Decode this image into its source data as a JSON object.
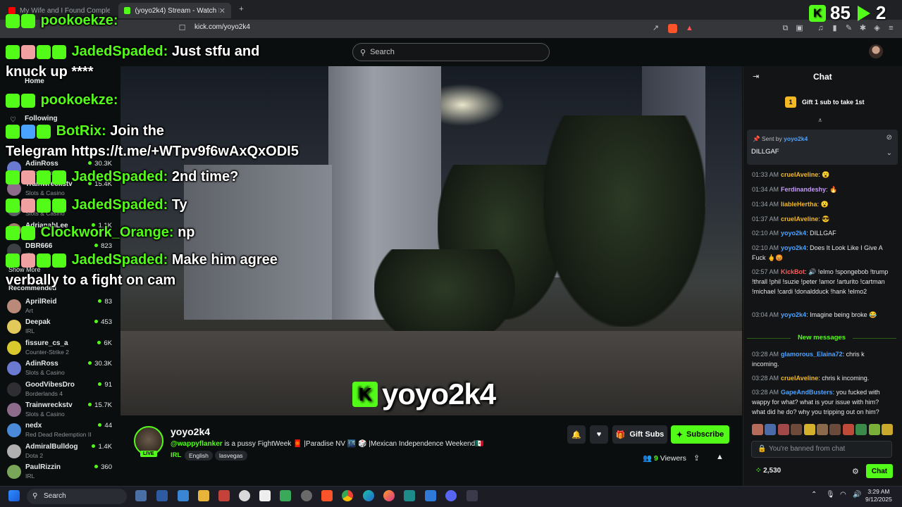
{
  "browser": {
    "tabs": [
      {
        "title": "My Wife and I Found Complex Prehi"
      },
      {
        "title": "(yoyo2k4) Stream - Watch Live"
      }
    ],
    "url": "kick.com/yoyo2k4"
  },
  "header": {
    "search_placeholder": "Search"
  },
  "sidebar": {
    "home": "Home",
    "following": "Following",
    "show_more": "Show More",
    "recommended": "Recommended",
    "following_channels": [
      {
        "name": "AdinRoss",
        "category": "Slots & Casino",
        "viewers": "30.3K"
      },
      {
        "name": "Trainwreckstv",
        "category": "Slots & Casino",
        "viewers": "15.4K"
      },
      {
        "name": "",
        "category": "Slots & Casino",
        "viewers": ""
      },
      {
        "name": "AdrianahLee",
        "category": "",
        "viewers": "1.1K"
      },
      {
        "name": "DBR666",
        "category": "IRL",
        "viewers": "823"
      }
    ],
    "recommended_channels": [
      {
        "name": "AprilReid",
        "category": "Art",
        "viewers": "83"
      },
      {
        "name": "Deepak",
        "category": "IRL",
        "viewers": "453"
      },
      {
        "name": "fissure_cs_a",
        "category": "Counter-Strike 2",
        "viewers": "6K"
      },
      {
        "name": "AdinRoss",
        "category": "Slots & Casino",
        "viewers": "30.3K"
      },
      {
        "name": "GoodVibesDro",
        "category": "Borderlands 4",
        "viewers": "91"
      },
      {
        "name": "Trainwreckstv",
        "category": "Slots & Casino",
        "viewers": "15.7K"
      },
      {
        "name": "nedx",
        "category": "Red Dead Redemption II",
        "viewers": "44"
      },
      {
        "name": "AdmiralBulldog",
        "category": "Dota 2",
        "viewers": "1.4K"
      },
      {
        "name": "PaulRizzin",
        "category": "IRL",
        "viewers": "360"
      }
    ]
  },
  "overlay": {
    "counter": {
      "a": "85",
      "b": "2"
    },
    "messages": [
      {
        "user": "pookoekze:",
        "text": ""
      },
      {
        "user": "JadedSpaded:",
        "text": "Just stfu and"
      },
      {
        "user": "",
        "text": "knuck up ****"
      },
      {
        "user": "pookoekze:",
        "text": ""
      },
      {
        "user": "BotRix:",
        "text": "Join the"
      },
      {
        "user": "",
        "text": "Telegram https://t.me/+WTpv9f6wAxQxODI5"
      },
      {
        "user": "JadedSpaded:",
        "text": "2nd time?"
      },
      {
        "user": "JadedSpaded:",
        "text": "Ty"
      },
      {
        "user": "Clockwork_Orange:",
        "text": "np"
      },
      {
        "user": "JadedSpaded:",
        "text": "Make him agree"
      },
      {
        "user": "",
        "text": "verbally to a fight on cam"
      }
    ]
  },
  "video": {
    "watermark": "yoyo2k4"
  },
  "stream": {
    "streamer": "yoyo2k4",
    "live": "LIVE",
    "mention": "@wappyflanker",
    "title_rest": " is a pussy FightWeek 🧧 |Paradise NV 🌃 🎲 |Mexican Independence Weekend🇲🇽",
    "category": "IRL",
    "tags": [
      "English",
      "lasvegas"
    ],
    "viewers_count": "9",
    "viewers_label": "Viewers",
    "gift_subs": "Gift Subs",
    "subscribe": "Subscribe"
  },
  "chat": {
    "title": "Chat",
    "gift_leader": "Gift 1 sub to take 1st",
    "gift_rank": "1",
    "pinned": {
      "sent_by": "Sent by",
      "user": "yoyo2k4",
      "message": "DILLGAF"
    },
    "new_messages": "New messages",
    "messages": [
      {
        "time": "01:33 AM",
        "user": "cruelAveline",
        "color": "#f3b824",
        "text": ": 😮"
      },
      {
        "time": "01:34 AM",
        "user": "Ferdinandeshy",
        "color": "#c49cf8",
        "text": ": 🔥"
      },
      {
        "time": "01:34 AM",
        "user": "liableHertha",
        "color": "#f3b824",
        "text": ": 😮"
      },
      {
        "time": "01:37 AM",
        "user": "cruelAveline",
        "color": "#f3b824",
        "text": ": 😎"
      },
      {
        "time": "02:10 AM",
        "user": "yoyo2k4",
        "color": "#4da3ff",
        "text": ": DILLGAF"
      },
      {
        "time": "02:10 AM",
        "user": "yoyo2k4",
        "color": "#4da3ff",
        "text": ": Does It Look Like I Give A Fuck 🖕😡"
      },
      {
        "time": "02:57 AM",
        "user": "KickBot",
        "color": "#ff5a5a",
        "text": ": 🔊 !elmo !spongebob !trump !thrall !phil !suzie !peter !amor !arturito !cartman !michael !cardi !donaldduck !hank !elmo2"
      },
      {
        "time": "03:04 AM",
        "user": "yoyo2k4",
        "color": "#4da3ff",
        "text": ": Imagine being broke 😂"
      },
      {
        "time": "03:28 AM",
        "user": "glamorous_Elaina72",
        "color": "#4da3ff",
        "text": ": chris k incoming."
      },
      {
        "time": "03:28 AM",
        "user": "cruelAveline",
        "color": "#f3b824",
        "text": ": chris k incoming."
      },
      {
        "time": "03:28 AM",
        "user": "GapeAndBusters",
        "color": "#4da3ff",
        "text": ": you fucked with wappy for what? what is your issue with him? what did he do? why you tripping out on him?"
      }
    ],
    "banned_placeholder": "You're banned from chat",
    "points": "2,530",
    "chat_button": "Chat"
  },
  "taskbar": {
    "search": "Search",
    "time": "3:29 AM",
    "date": "9/12/2025"
  },
  "colors": {
    "accent": "#53fc18",
    "background": "#0b0e0f",
    "panel": "#121416"
  }
}
